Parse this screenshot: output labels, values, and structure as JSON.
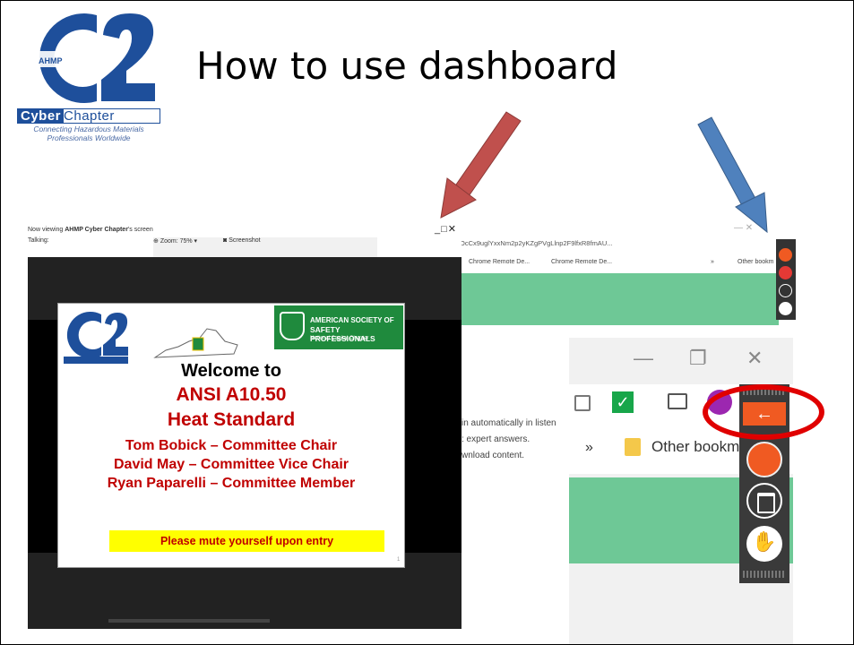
{
  "slide_title": "How to use dashboard",
  "logo": {
    "brand": "AHMP",
    "word_bold": "Cyber",
    "word_light": "Chapter",
    "tagline_1": "Connecting Hazardous Materials",
    "tagline_2": "Professionals Worldwide"
  },
  "viewer": {
    "title_prefix": "Now viewing ",
    "title_bold": "AHMP Cyber Chapter",
    "title_suffix": "'s screen",
    "talking": "Talking:",
    "zoom": "Zoom: 75% ▾",
    "screenshot": "Screenshot",
    "window_controls": "_□✕"
  },
  "presentation": {
    "asse_l1": "AMERICAN SOCIETY OF",
    "asse_l2": "SAFETY PROFESSIONALS",
    "asse_l3": "National Capital Chapter",
    "welcome": "Welcome to",
    "ansi": "ANSI A10.50",
    "heat": "Heat Standard",
    "names": [
      "Tom Bobick – Committee Chair",
      "David May – Committee Vice Chair",
      "Ryan Paparelli – Committee Member"
    ],
    "mute": "Please mute yourself upon entry",
    "page": "1"
  },
  "browser": {
    "window_controls": "—  ✕",
    "address": "OcCx9uglYxxNm2p2yKZgPVgLlnp2F9lfxR8fmAU...",
    "bookmark_1": "Chrome Remote De...",
    "bookmark_2": "Chrome Remote De...",
    "bookmark_more": "»",
    "bookmark_other": "Other bookm",
    "page_lines": [
      "in automatically in listen",
      ": expert answers.",
      "wnload content."
    ]
  },
  "zoomed": {
    "minimize": "—",
    "restore": "❐",
    "close": "✕",
    "chevron": "»",
    "other_bookmarks": "Other bookm",
    "back_arrow": "←"
  },
  "colors": {
    "accent_green": "#6ec896",
    "orange": "#f05a22",
    "ring_red": "#e00000",
    "arrow_red": "#c0504d",
    "arrow_blue": "#4f81bd"
  }
}
